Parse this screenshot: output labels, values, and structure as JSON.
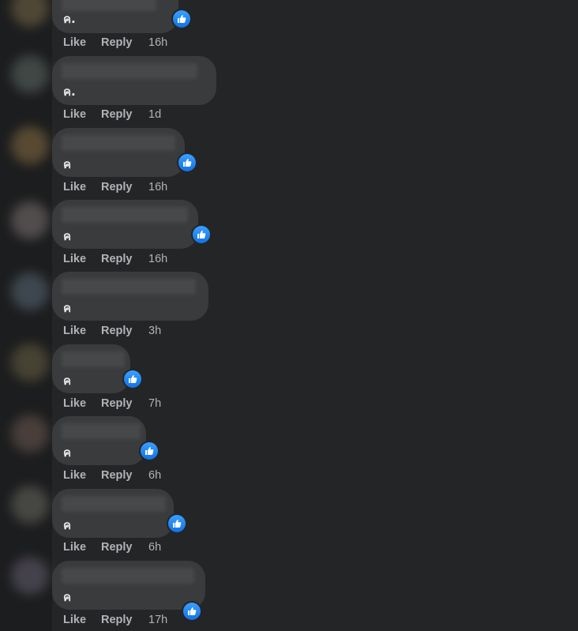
{
  "colors": {
    "background": "#242526",
    "bubble": "#3a3b3c",
    "text": "#e4e6eb",
    "muted": "#b0b3b8",
    "reaction_blue": "#1877f2"
  },
  "comments": [
    {
      "text": "ค.",
      "like_label": "Like",
      "reply_label": "Reply",
      "time": "16h",
      "reaction": "like-icon"
    },
    {
      "text": "ค.",
      "like_label": "Like",
      "reply_label": "Reply",
      "time": "1d",
      "reaction": null
    },
    {
      "text": "ค",
      "like_label": "Like",
      "reply_label": "Reply",
      "time": "16h",
      "reaction": "like-icon"
    },
    {
      "text": "ค",
      "like_label": "Like",
      "reply_label": "Reply",
      "time": "16h",
      "reaction": "like-icon"
    },
    {
      "text": "ค",
      "like_label": "Like",
      "reply_label": "Reply",
      "time": "3h",
      "reaction": null
    },
    {
      "text": "ค",
      "like_label": "Like",
      "reply_label": "Reply",
      "time": "7h",
      "reaction": "like-icon"
    },
    {
      "text": "ค",
      "like_label": "Like",
      "reply_label": "Reply",
      "time": "6h",
      "reaction": "like-icon"
    },
    {
      "text": "ค",
      "like_label": "Like",
      "reply_label": "Reply",
      "time": "6h",
      "reaction": "like-icon"
    },
    {
      "text": "ค",
      "like_label": "Like",
      "reply_label": "Reply",
      "time": "17h",
      "reaction": "like-icon"
    }
  ]
}
